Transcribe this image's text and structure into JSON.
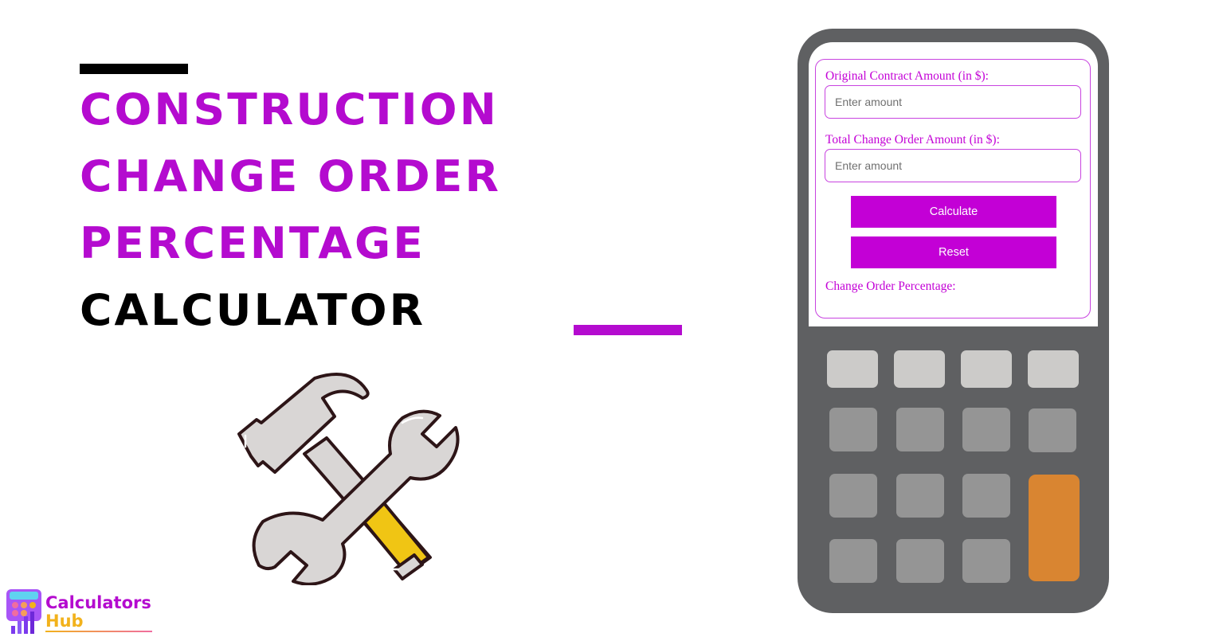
{
  "hero": {
    "title_lines": [
      "Construction",
      "Change Order",
      "Percentage",
      "Calculator"
    ],
    "accent_color": "#b40bcf",
    "text_color_dark": "#000000"
  },
  "illustration": {
    "name": "hammer-and-wrench",
    "colors": {
      "metal": "#d9d6d5",
      "handle": "#f0c514",
      "outline": "#2d1517"
    }
  },
  "logo": {
    "line1": "Calculators",
    "line2": "Hub",
    "colors": {
      "primary": "#b40bcf",
      "secondary": "#f2b21c"
    }
  },
  "calculator": {
    "fields": [
      {
        "label": "Original Contract Amount (in $):",
        "placeholder": "Enter amount",
        "value": ""
      },
      {
        "label": "Total Change Order Amount (in $):",
        "placeholder": "Enter amount",
        "value": ""
      }
    ],
    "buttons": {
      "calculate": "Calculate",
      "reset": "Reset"
    },
    "result_label": "Change Order Percentage:",
    "result_value": "",
    "colors": {
      "accent": "#c300d6",
      "body": "#5f6062",
      "key": "#959595",
      "key_light": "#cccbc9",
      "key_orange": "#d98531"
    }
  }
}
